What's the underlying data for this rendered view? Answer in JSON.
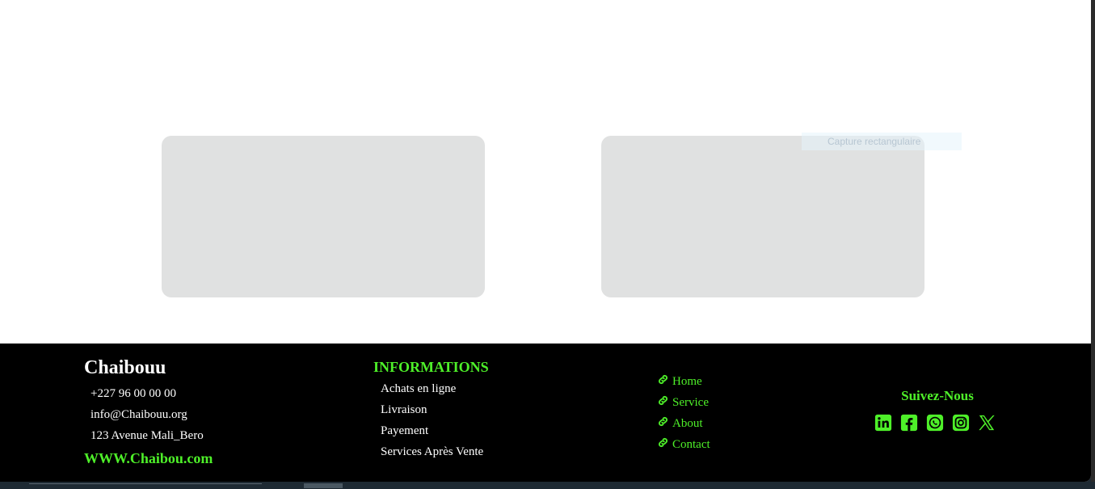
{
  "main": {
    "tooltip": "Capture rectangulaire"
  },
  "footer": {
    "brand": "Chaibouu",
    "phone": "+227 96 00 00 00",
    "email": "info@Chaibouu.org",
    "address": "123 Avenue Mali_Bero",
    "website": "WWW.Chaibou.com",
    "info_title": "INFORMATIONS",
    "info_items": [
      "Achats en ligne",
      "Livraison",
      "Payement",
      "Services Après Vente"
    ],
    "nav_links": [
      {
        "label": "Home",
        "icon": "link-icon"
      },
      {
        "label": "Service",
        "icon": "link-icon"
      },
      {
        "label": "About",
        "icon": "link-icon"
      },
      {
        "label": "Contact",
        "icon": "link-icon"
      }
    ],
    "follow_title": "Suivez-Nous",
    "socials": [
      "linkedin-icon",
      "facebook-icon",
      "whatsapp-icon",
      "instagram-icon",
      "x-icon"
    ]
  },
  "colors": {
    "accent": "#4ef029",
    "footer_bg": "#000000",
    "card_bg": "#e0e1e1"
  }
}
